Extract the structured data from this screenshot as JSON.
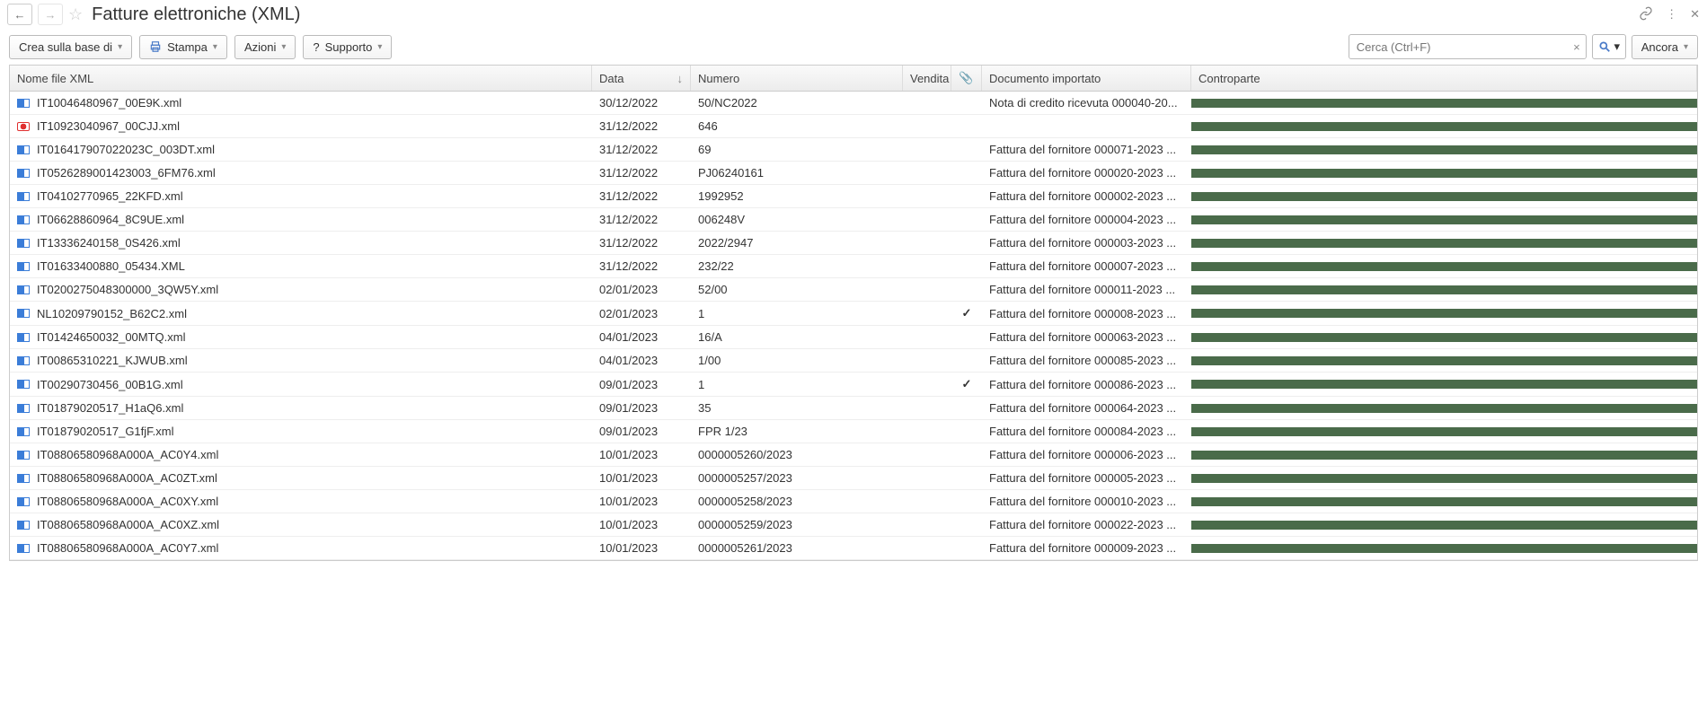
{
  "title": "Fatture elettroniche (XML)",
  "toolbar": {
    "create": "Crea sulla base di",
    "print": "Stampa",
    "actions": "Azioni",
    "help_prefix": "?",
    "help": "Supporto",
    "search_placeholder": "Cerca (Ctrl+F)",
    "more": "Ancora"
  },
  "columns": {
    "file": "Nome file XML",
    "date": "Data",
    "number": "Numero",
    "sale": "Vendita",
    "attach": "📎",
    "doc": "Documento importato",
    "cparte": "Controparte"
  },
  "rows": [
    {
      "icon": "blue",
      "file": "IT10046480967_00E9K.xml",
      "date": "30/12/2022",
      "num": "50/NC2022",
      "att": "",
      "doc": "Nota di credito ricevuta 000040-20..."
    },
    {
      "icon": "red",
      "file": "IT10923040967_00CJJ.xml",
      "date": "31/12/2022",
      "num": "646",
      "att": "",
      "doc": ""
    },
    {
      "icon": "blue",
      "file": "IT016417907022023C_003DT.xml",
      "date": "31/12/2022",
      "num": "69",
      "att": "",
      "doc": "Fattura del fornitore 000071-2023 ..."
    },
    {
      "icon": "blue",
      "file": "IT0526289001423003_6FM76.xml",
      "date": "31/12/2022",
      "num": "PJ06240161",
      "att": "",
      "doc": "Fattura del fornitore 000020-2023 ..."
    },
    {
      "icon": "blue",
      "file": "IT04102770965_22KFD.xml",
      "date": "31/12/2022",
      "num": "1992952",
      "att": "",
      "doc": "Fattura del fornitore 000002-2023 ..."
    },
    {
      "icon": "blue",
      "file": "IT06628860964_8C9UE.xml",
      "date": "31/12/2022",
      "num": "006248V",
      "att": "",
      "doc": "Fattura del fornitore 000004-2023 ..."
    },
    {
      "icon": "blue",
      "file": "IT13336240158_0S426.xml",
      "date": "31/12/2022",
      "num": "2022/2947",
      "att": "",
      "doc": "Fattura del fornitore 000003-2023 ..."
    },
    {
      "icon": "blue",
      "file": "IT01633400880_05434.XML",
      "date": "31/12/2022",
      "num": "232/22",
      "att": "",
      "doc": "Fattura del fornitore 000007-2023 ..."
    },
    {
      "icon": "blue",
      "file": "IT0200275048300000_3QW5Y.xml",
      "date": "02/01/2023",
      "num": "52/00",
      "att": "",
      "doc": "Fattura del fornitore 000011-2023 ..."
    },
    {
      "icon": "blue",
      "file": "NL10209790152_B62C2.xml",
      "date": "02/01/2023",
      "num": "1",
      "att": "✓",
      "doc": "Fattura del fornitore 000008-2023 ..."
    },
    {
      "icon": "blue",
      "file": "IT01424650032_00MTQ.xml",
      "date": "04/01/2023",
      "num": "16/A",
      "att": "",
      "doc": "Fattura del fornitore 000063-2023 ..."
    },
    {
      "icon": "blue",
      "file": "IT00865310221_KJWUB.xml",
      "date": "04/01/2023",
      "num": "1/00",
      "att": "",
      "doc": "Fattura del fornitore 000085-2023 ..."
    },
    {
      "icon": "blue",
      "file": "IT00290730456_00B1G.xml",
      "date": "09/01/2023",
      "num": "1",
      "att": "✓",
      "doc": "Fattura del fornitore 000086-2023 ..."
    },
    {
      "icon": "blue",
      "file": "IT01879020517_H1aQ6.xml",
      "date": "09/01/2023",
      "num": "35",
      "att": "",
      "doc": "Fattura del fornitore 000064-2023 ..."
    },
    {
      "icon": "blue",
      "file": "IT01879020517_G1fjF.xml",
      "date": "09/01/2023",
      "num": "FPR 1/23",
      "att": "",
      "doc": "Fattura del fornitore 000084-2023 ..."
    },
    {
      "icon": "blue",
      "file": "IT08806580968A000A_AC0Y4.xml",
      "date": "10/01/2023",
      "num": "0000005260/2023",
      "att": "",
      "doc": "Fattura del fornitore 000006-2023 ..."
    },
    {
      "icon": "blue",
      "file": "IT08806580968A000A_AC0ZT.xml",
      "date": "10/01/2023",
      "num": "0000005257/2023",
      "att": "",
      "doc": "Fattura del fornitore 000005-2023 ..."
    },
    {
      "icon": "blue",
      "file": "IT08806580968A000A_AC0XY.xml",
      "date": "10/01/2023",
      "num": "0000005258/2023",
      "att": "",
      "doc": "Fattura del fornitore 000010-2023 ..."
    },
    {
      "icon": "blue",
      "file": "IT08806580968A000A_AC0XZ.xml",
      "date": "10/01/2023",
      "num": "0000005259/2023",
      "att": "",
      "doc": "Fattura del fornitore 000022-2023 ..."
    },
    {
      "icon": "blue",
      "file": "IT08806580968A000A_AC0Y7.xml",
      "date": "10/01/2023",
      "num": "0000005261/2023",
      "att": "",
      "doc": "Fattura del fornitore 000009-2023 ..."
    }
  ]
}
